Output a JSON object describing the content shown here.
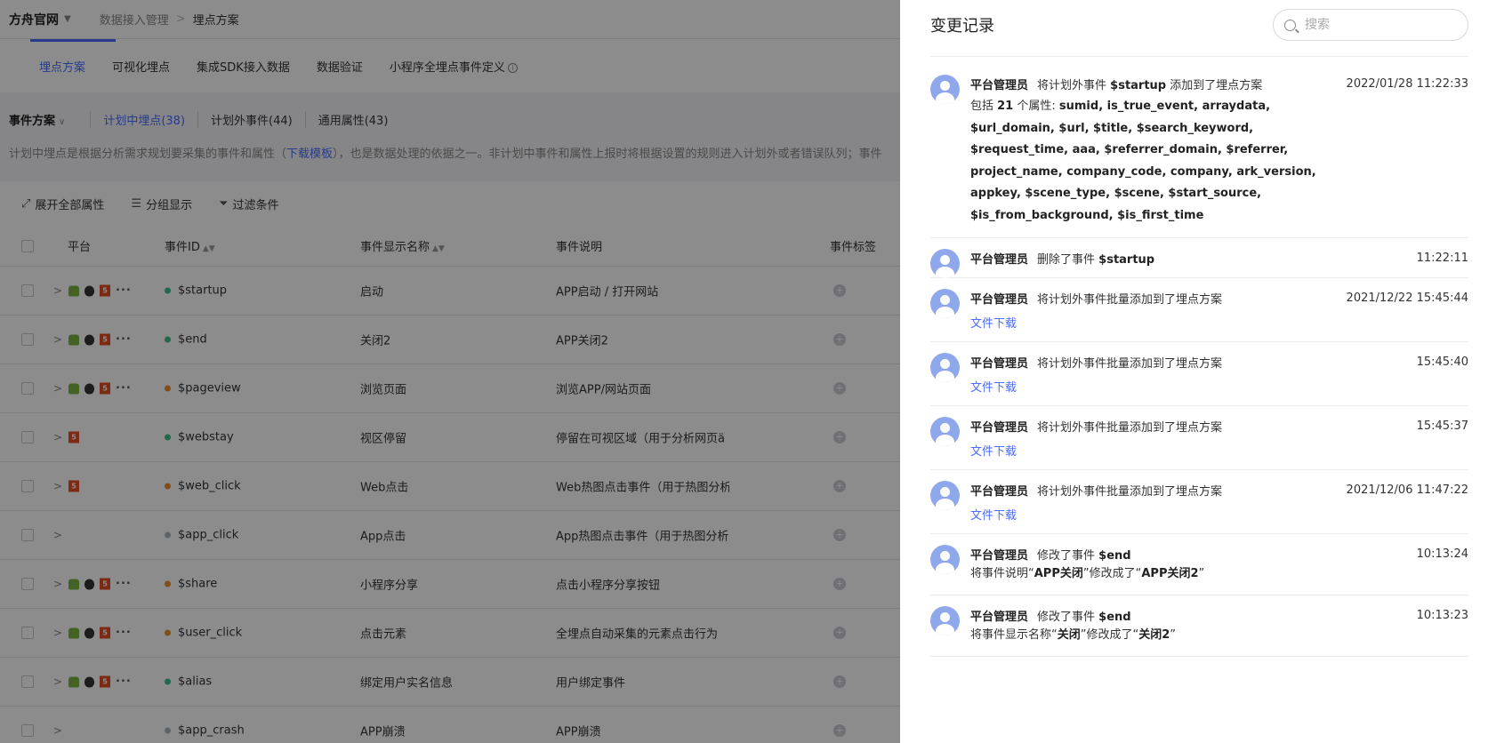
{
  "topbar": {
    "brand": "方舟官网",
    "breadcrumb": [
      "数据接入管理",
      "埋点方案"
    ]
  },
  "tabs": [
    "埋点方案",
    "可视化埋点",
    "集成SDK接入数据",
    "数据验证",
    "小程序全埋点事件定义"
  ],
  "scheme": {
    "title": "事件方案",
    "links": [
      "计划中埋点(38)",
      "计划外事件(44)",
      "通用属性(43)"
    ],
    "desc_pre": "计划中埋点是根据分析需求规划要采集的事件和属性（",
    "desc_link": "下载模板",
    "desc_post": "），也是数据处理的依据之一。非计划中事件和属性上报时将根据设置的规则进入计划外或者错误队列；事件"
  },
  "toolbar": {
    "expand": "展开全部属性",
    "group": "分组显示",
    "filter": "过滤条件"
  },
  "table": {
    "headers": {
      "platform": "平台",
      "event_id": "事件ID",
      "display_name": "事件显示名称",
      "desc": "事件说明",
      "tag": "事件标签"
    },
    "rows": [
      {
        "id": "$startup",
        "name": "启动",
        "desc": "APP启动 / 打开网站",
        "dot": "#3bbf8a",
        "platforms": "full"
      },
      {
        "id": "$end",
        "name": "关闭2",
        "desc": "APP关闭2",
        "dot": "#3bbf8a",
        "platforms": "full"
      },
      {
        "id": "$pageview",
        "name": "浏览页面",
        "desc": "浏览APP/网站页面",
        "dot": "#f08c2a",
        "platforms": "full"
      },
      {
        "id": "$webstay",
        "name": "视区停留",
        "desc": "停留在可视区域（用于分析网页ä",
        "dot": "#3bbf8a",
        "platforms": "h5"
      },
      {
        "id": "$web_click",
        "name": "Web点击",
        "desc": "Web热图点击事件（用于热图分析",
        "dot": "#f08c2a",
        "platforms": "h5"
      },
      {
        "id": "$app_click",
        "name": "App点击",
        "desc": "App热图点击事件（用于热图分析",
        "dot": "#b0b4b9",
        "platforms": "none"
      },
      {
        "id": "$share",
        "name": "小程序分享",
        "desc": "点击小程序分享按钮",
        "dot": "#f08c2a",
        "platforms": "full"
      },
      {
        "id": "$user_click",
        "name": "点击元素",
        "desc": "全埋点自动采集的元素点击行为",
        "dot": "#f08c2a",
        "platforms": "full"
      },
      {
        "id": "$alias",
        "name": "绑定用户实名信息",
        "desc": "用户绑定事件",
        "dot": "#3bbf8a",
        "platforms": "full"
      },
      {
        "id": "$app_crash",
        "name": "APP崩溃",
        "desc": "APP崩溃",
        "dot": "#b0b4b9",
        "platforms": "none"
      }
    ]
  },
  "drawer": {
    "title": "变更记录",
    "search_placeholder": "搜索",
    "download_label": "文件下载",
    "logs": [
      {
        "user": "平台管理员",
        "action_pre": "将计划外事件 ",
        "action_bold": "$startup",
        "action_post": " 添加到了埋点方案",
        "time": "2022/01/28 11:22:33",
        "detail_pre": "包括 ",
        "detail_count": "21",
        "detail_mid": " 个属性: ",
        "detail_list": "sumid, is_true_event, arraydata, $url_domain, $url, $title, $search_keyword, $request_time, aaa, $referrer_domain, $referrer, project_name, company_code, company, ark_version, appkey, $scene_type, $scene, $start_source, $is_from_background, $is_first_time"
      },
      {
        "user": "平台管理员",
        "action_pre": "删除了事件 ",
        "action_bold": "$startup",
        "action_post": "",
        "time": "11:22:11"
      },
      {
        "user": "平台管理员",
        "action_pre": "将计划外事件批量添加到了埋点方案",
        "action_bold": "",
        "action_post": "",
        "time": "2021/12/22 15:45:44",
        "download": true
      },
      {
        "user": "平台管理员",
        "action_pre": "将计划外事件批量添加到了埋点方案",
        "action_bold": "",
        "action_post": "",
        "time": "15:45:40",
        "download": true
      },
      {
        "user": "平台管理员",
        "action_pre": "将计划外事件批量添加到了埋点方案",
        "action_bold": "",
        "action_post": "",
        "time": "15:45:37",
        "download": true
      },
      {
        "user": "平台管理员",
        "action_pre": "将计划外事件批量添加到了埋点方案",
        "action_bold": "",
        "action_post": "",
        "time": "2021/12/06 11:47:22",
        "download": true
      },
      {
        "user": "平台管理员",
        "action_pre": "修改了事件 ",
        "action_bold": "$end",
        "action_post": "",
        "time": "10:13:24",
        "change_pre": "将事件说明“",
        "change_from": "APP关闭",
        "change_mid": "”修改成了“",
        "change_to": "APP关闭2",
        "change_post": "”"
      },
      {
        "user": "平台管理员",
        "action_pre": "修改了事件 ",
        "action_bold": "$end",
        "action_post": "",
        "time": "10:13:23",
        "change_pre": "将事件显示名称“",
        "change_from": "关闭",
        "change_mid": "”修改成了“",
        "change_to": "关闭2",
        "change_post": "”"
      }
    ]
  }
}
